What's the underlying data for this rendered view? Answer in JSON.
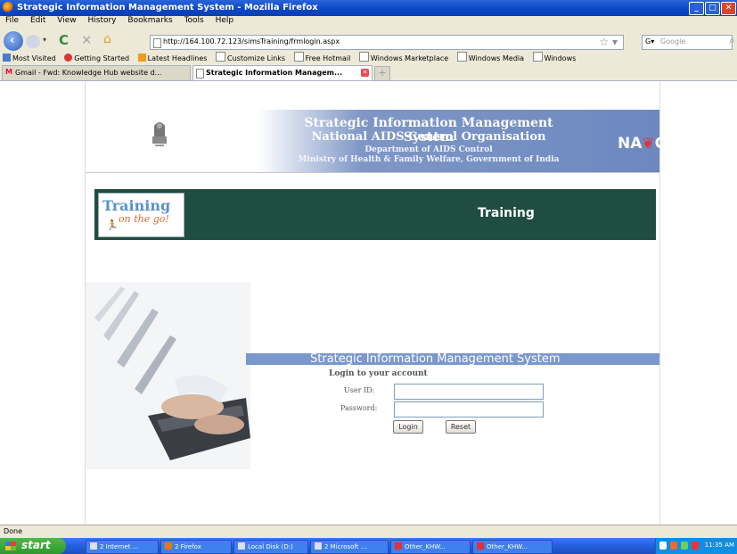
{
  "window": {
    "title": "Strategic Information Management System - Mozilla Firefox"
  },
  "menu": [
    "File",
    "Edit",
    "View",
    "History",
    "Bookmarks",
    "Tools",
    "Help"
  ],
  "nav": {
    "url": "http://164.100.72.123/simsTraining/frmlogin.aspx",
    "search_placeholder": "Google"
  },
  "bookmarks": [
    "Most Visited",
    "Getting Started",
    "Latest Headlines",
    "Customize Links",
    "Free Hotmail",
    "Windows Marketplace",
    "Windows Media",
    "Windows"
  ],
  "tabs": [
    {
      "label": "Gmail - Fwd: Knowledge Hub website d..."
    },
    {
      "label": "Strategic Information Managem..."
    }
  ],
  "banner": {
    "line1": "Strategic Information Management System",
    "line2": "National AIDS Control Organisation",
    "line3": "Department of AIDS Control",
    "line4": "Ministry of Health & Family Welfare, Government of India",
    "logo_text_left": "NA",
    "logo_text_right": "CO"
  },
  "training": {
    "logo_word": "Training",
    "logo_tagline": "on the go!",
    "heading": "Training"
  },
  "login": {
    "system_title": "Strategic Information Management System",
    "subtitle": "Login to your account",
    "user_label": "User ID:",
    "password_label": "Password:",
    "user_value": "",
    "password_value": "",
    "login_button": "Login",
    "reset_button": "Reset"
  },
  "status": {
    "text": "Done"
  },
  "taskbar": {
    "start_label": "start",
    "items": [
      "2 Internet ...",
      "2 Firefox",
      "Local Disk (D:)",
      "2 Microsoft ...",
      "Other_KHW...",
      "Other_KHW..."
    ],
    "clock": "11:35 AM"
  },
  "colors": {
    "banner_blue": "#6c88bf",
    "training_bar": "#1f4d40",
    "system_bar": "#7a98cd",
    "naco_ribbon": "#e0323c"
  }
}
